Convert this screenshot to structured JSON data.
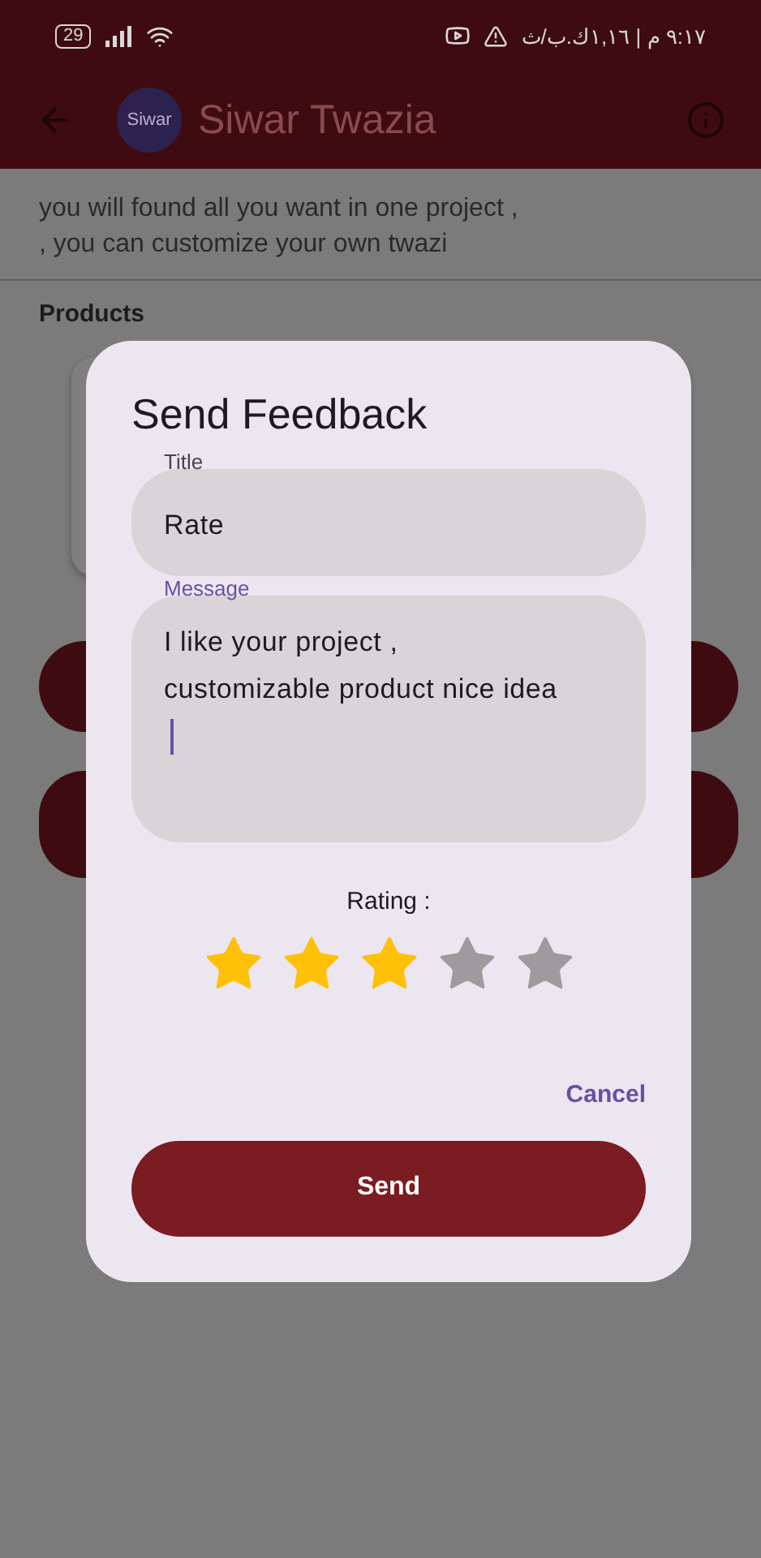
{
  "status_bar": {
    "battery": "29",
    "time": "٩:١٧ م | ١,١٦ك.ب/ث"
  },
  "app_bar": {
    "logo_text": "Siwar",
    "title": "Siwar Twazia"
  },
  "description": "you will found all you want in one project ,\n, you can customize your own twazi",
  "section_title": "Products",
  "dialog": {
    "title": "Send Feedback",
    "fields": [
      {
        "label": "Title",
        "value": "Rate",
        "focused": false
      },
      {
        "label": "Message",
        "value": "I like your project ,\ncustomizable product nice idea",
        "focused": true
      }
    ],
    "rating_label": "Rating :",
    "stars": 3,
    "cancel": "Cancel",
    "send": "Send"
  }
}
